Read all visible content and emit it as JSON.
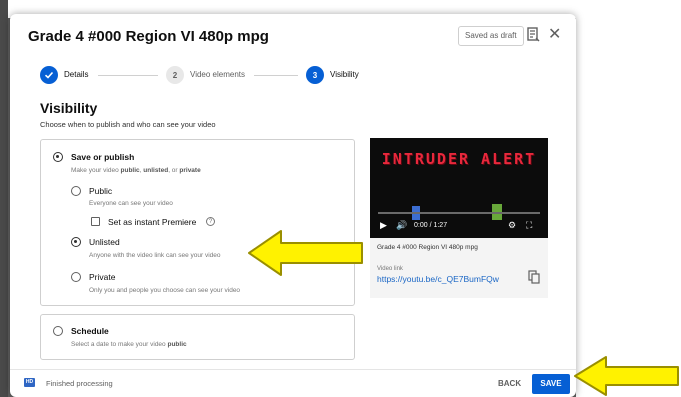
{
  "dialog": {
    "title": "Grade 4 #000 Region VI 480p mpg",
    "draft_badge": "Saved as draft",
    "report_icon": "flag-report-icon",
    "close_icon": "close-icon"
  },
  "stepper": {
    "steps": [
      {
        "label": "Details",
        "marker": "",
        "state": "done"
      },
      {
        "label": "Video elements",
        "marker": "2",
        "state": "pending"
      },
      {
        "label": "Visibility",
        "marker": "3",
        "state": "active"
      }
    ]
  },
  "visibility": {
    "title": "Visibility",
    "subtitle": "Choose when to publish and who can see your video",
    "save_or_publish": {
      "label": "Save or publish",
      "desc_prefix": "Make your video ",
      "desc_public": "public",
      "desc_sep1": ", ",
      "desc_unlisted": "unlisted",
      "desc_sep2": ", or ",
      "desc_private": "private",
      "selected": true
    },
    "options": {
      "public": {
        "label": "Public",
        "desc": "Everyone can see your video",
        "selected": false
      },
      "premiere": {
        "label": "Set as instant Premiere",
        "checked": false,
        "help": "?"
      },
      "unlisted": {
        "label": "Unlisted",
        "desc": "Anyone with the video link can see your video",
        "selected": true
      },
      "private": {
        "label": "Private",
        "desc": "Only you and people you choose can see your video",
        "selected": false
      }
    },
    "schedule": {
      "label": "Schedule",
      "desc_prefix": "Select a date to make your video ",
      "desc_bold": "public",
      "selected": false
    }
  },
  "preview": {
    "video_overlay_text": "INTRUDER ALERT",
    "time": "0:00 / 1:27",
    "title": "Grade 4 #000 Region VI 480p mpg",
    "link_label": "Video link",
    "link": "https://youtu.be/c_QE7BumFQw",
    "icons": [
      "play-icon",
      "volume-icon",
      "settings-icon",
      "fullscreen-icon",
      "copy-icon"
    ]
  },
  "footer": {
    "status_icon": "hd-icon",
    "status_icon_text": "HD",
    "status": "Finished processing",
    "back_label": "BACK",
    "save_label": "SAVE"
  },
  "colors": {
    "accent": "#065fd4",
    "arrow_fill": "#fff200",
    "arrow_stroke": "#9a8f00",
    "video_title": "#e8283c"
  }
}
